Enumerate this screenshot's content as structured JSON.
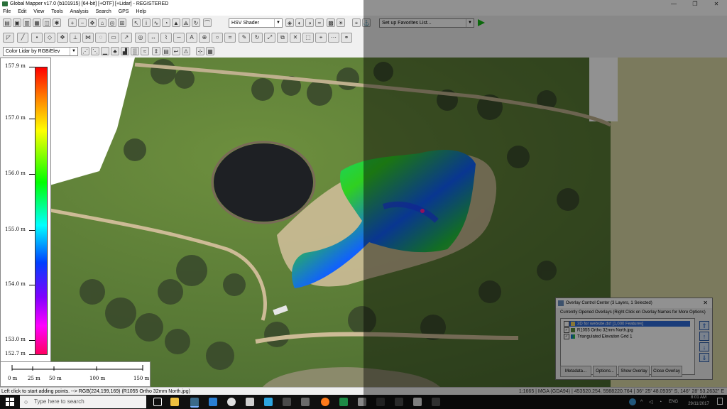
{
  "window": {
    "title": "Global Mapper v17.0 (b101915) [64-bit] [+OTF] [+Lidar] - REGISTERED",
    "controls": [
      "—",
      "❐",
      "✕"
    ]
  },
  "menu": [
    "File",
    "Edit",
    "View",
    "Tools",
    "Analysis",
    "Search",
    "GPS",
    "Help"
  ],
  "toolbar": {
    "shader_select": "HSV Shader",
    "favorites_select": "Set up Favorites List...",
    "lidar_color_select": "Color Lidar by RGB/Elev",
    "run_icon": "play-icon"
  },
  "legend": {
    "ticks": [
      "157.9 m",
      "157.0 m",
      "156.0 m",
      "155.0 m",
      "154.0 m",
      "153.0 m",
      "152.7 m"
    ]
  },
  "scale_bar": {
    "labels": [
      "0 m",
      "25 m",
      "50 m",
      "100 m",
      "150 m"
    ]
  },
  "status": {
    "left": "Left click to start adding points. --> RGB(224,199,169) (R1055 Ortho 32mm North.jpg)",
    "right": "1:1665 | MGA (GDA94) | 453520.254, 5988220.764 | 36° 25' 48.0935\" S, 146° 28' 53.2632\" E"
  },
  "overlay_control_center": {
    "title": "Overlay Control Center (3 Layers, 1 Selected)",
    "header": "Currently Opened Overlays (Right Click on Overlay Names for More Options)",
    "layers": [
      {
        "name": "3D for website.dxf [1,000 Features]",
        "checked": false,
        "selected": true
      },
      {
        "name": "R1055 Ortho 32mm North.jpg",
        "checked": true,
        "selected": false
      },
      {
        "name": "Triangulated Elevation Grid 1",
        "checked": true,
        "selected": false
      }
    ],
    "buttons": [
      "Metadata...",
      "Options...",
      "Show Overlay",
      "Close Overlay"
    ]
  },
  "taskbar": {
    "search_placeholder": "Type here to search",
    "language": "ENG",
    "time": "8:01 AM",
    "date": "29/11/2017"
  }
}
